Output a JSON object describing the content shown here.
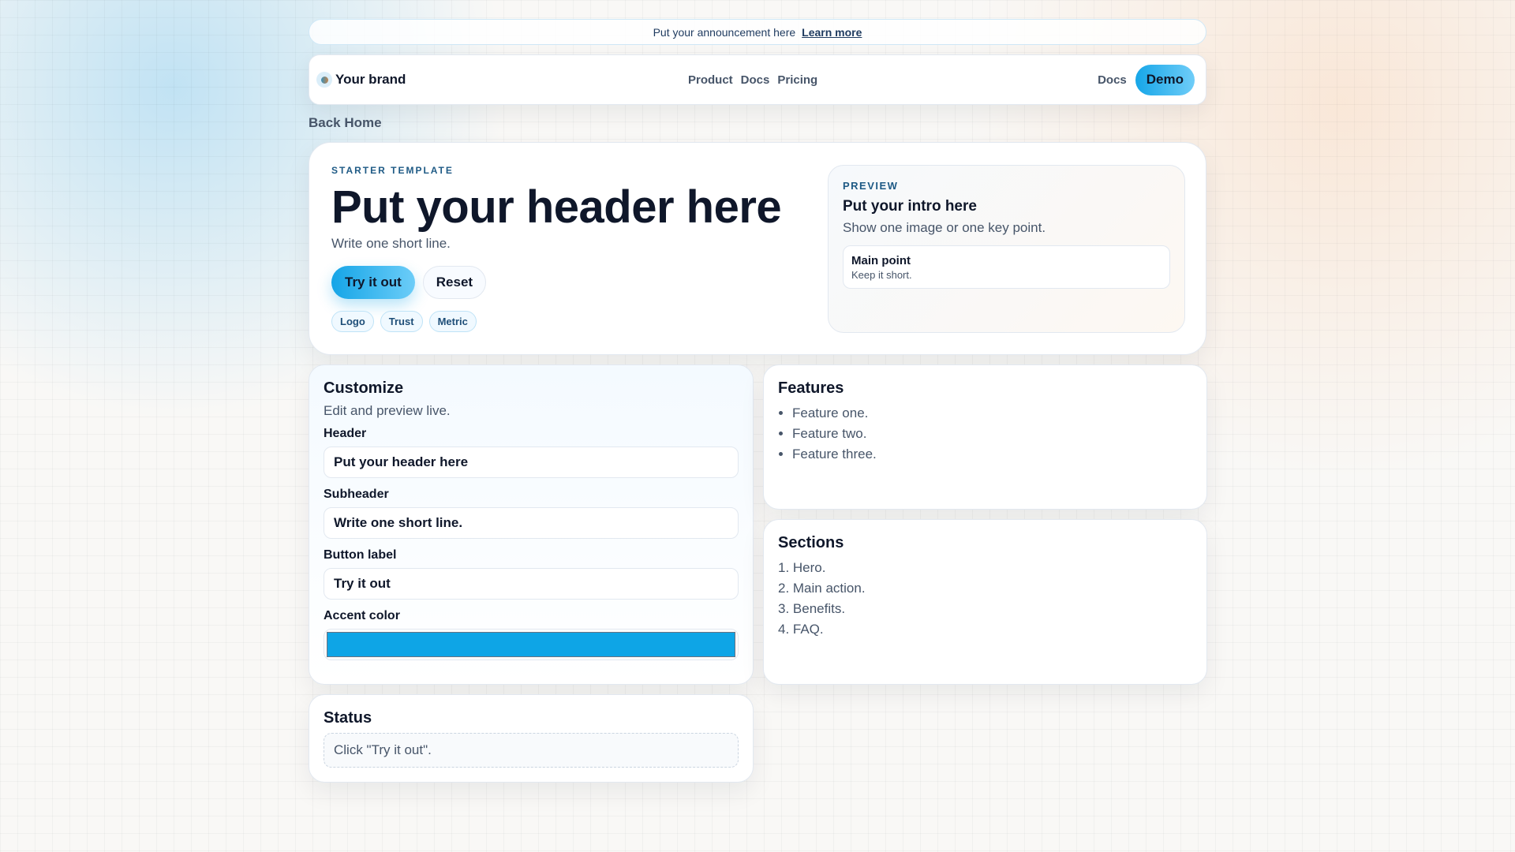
{
  "announcement": {
    "text": "Put your announcement here",
    "link": "Learn more"
  },
  "nav": {
    "brand": "Your brand",
    "links": [
      "Product",
      "Docs",
      "Pricing"
    ],
    "right_link": "Docs",
    "cta": "Demo"
  },
  "back": "Back Home",
  "hero": {
    "eyebrow": "STARTER TEMPLATE",
    "title": "Put your header here",
    "subtitle": "Write one short line.",
    "primary": "Try it out",
    "secondary": "Reset",
    "chips": [
      "Logo",
      "Trust",
      "Metric"
    ],
    "preview": {
      "eyebrow": "PREVIEW",
      "title": "Put your intro here",
      "subtitle": "Show one image or one key point.",
      "box_title": "Main point",
      "box_text": "Keep it short."
    }
  },
  "customize": {
    "title": "Customize",
    "desc": "Edit and preview live.",
    "fields": [
      {
        "label": "Header",
        "value": "Put your header here"
      },
      {
        "label": "Subheader",
        "value": "Write one short line."
      },
      {
        "label": "Button label",
        "value": "Try it out"
      }
    ],
    "accent_label": "Accent color",
    "accent": "#0ea5e6"
  },
  "features": {
    "title": "Features",
    "items": [
      "Feature one.",
      "Feature two.",
      "Feature three."
    ]
  },
  "sections": {
    "title": "Sections",
    "items": [
      "1. Hero.",
      "2. Main action.",
      "3. Benefits.",
      "4. FAQ."
    ]
  },
  "status": {
    "title": "Status",
    "text": "Click \"Try it out\"."
  }
}
